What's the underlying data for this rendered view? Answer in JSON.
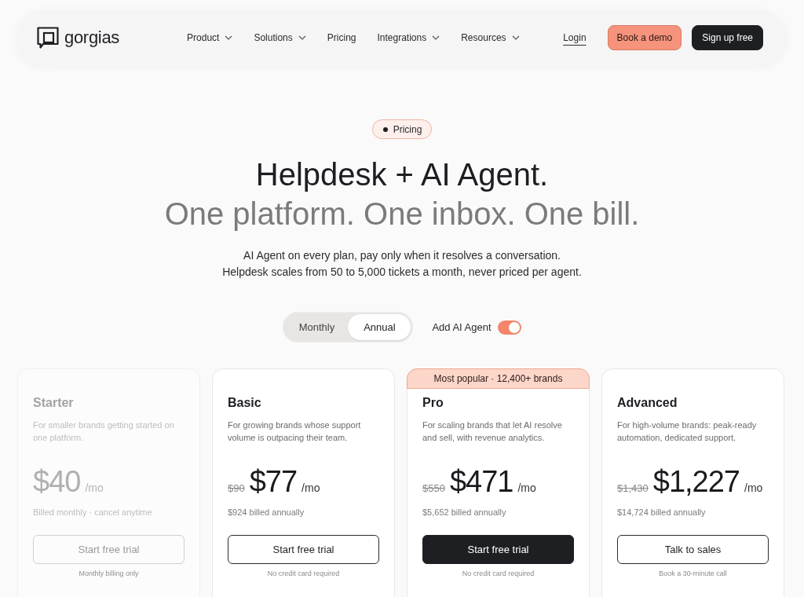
{
  "nav": {
    "brand": "gorgias",
    "links": [
      {
        "label": "Product",
        "dropdown": true
      },
      {
        "label": "Solutions",
        "dropdown": true
      },
      {
        "label": "Pricing",
        "dropdown": false
      },
      {
        "label": "Integrations",
        "dropdown": true
      },
      {
        "label": "Resources",
        "dropdown": true
      }
    ],
    "login": "Login",
    "buttons": [
      {
        "label": "Book a demo",
        "kind": "accent"
      },
      {
        "label": "Sign up free",
        "kind": "dark"
      }
    ]
  },
  "hero": {
    "tag": "Pricing",
    "title": "Helpdesk + AI Agent.",
    "subtitle": "One platform. One inbox. One bill.",
    "description": [
      "AI Agent on every plan, pay only when it resolves a conversation.",
      "Helpdesk scales from 50 to 5,000 tickets a month, never priced per agent."
    ]
  },
  "billing": {
    "options": [
      {
        "label": "Monthly",
        "selected": false
      },
      {
        "label": "Annual",
        "selected": true
      }
    ],
    "ai_agent": {
      "label": "Add AI Agent",
      "on": true
    }
  },
  "plans": [
    {
      "name": "Starter",
      "disabled": true,
      "description": "For smaller brands getting started on one platform.",
      "price": "$40",
      "unit": "/mo",
      "billed": "Billed monthly · cancel anytime",
      "button": {
        "label": "Start free trial",
        "kind": "outline"
      },
      "note": "Monthly billing only"
    },
    {
      "name": "Basic",
      "disabled": false,
      "description": "For growing brands whose support volume is outpacing their team.",
      "old_price": "$90",
      "price": "$77",
      "unit": "/mo",
      "billed": "$924 billed annually",
      "button": {
        "label": "Start free trial",
        "kind": "outline"
      },
      "note": "No credit card required"
    },
    {
      "name": "Pro",
      "disabled": false,
      "badge": "Most popular · 12,400+ brands",
      "description": "For scaling brands that let AI resolve and sell, with revenue analytics.",
      "old_price": "$550",
      "price": "$471",
      "unit": "/mo",
      "billed": "$5,652 billed annually",
      "button": {
        "label": "Start free trial",
        "kind": "primary"
      },
      "note": "No credit card required"
    },
    {
      "name": "Advanced",
      "disabled": false,
      "description": "For high-volume brands: peak-ready automation, dedicated support.",
      "old_price": "$1,430",
      "price": "$1,227",
      "unit": "/mo",
      "billed": "$14,724 billed annually",
      "button": {
        "label": "Talk to sales",
        "kind": "outline"
      },
      "note": "Book a 30-minute call"
    }
  ]
}
